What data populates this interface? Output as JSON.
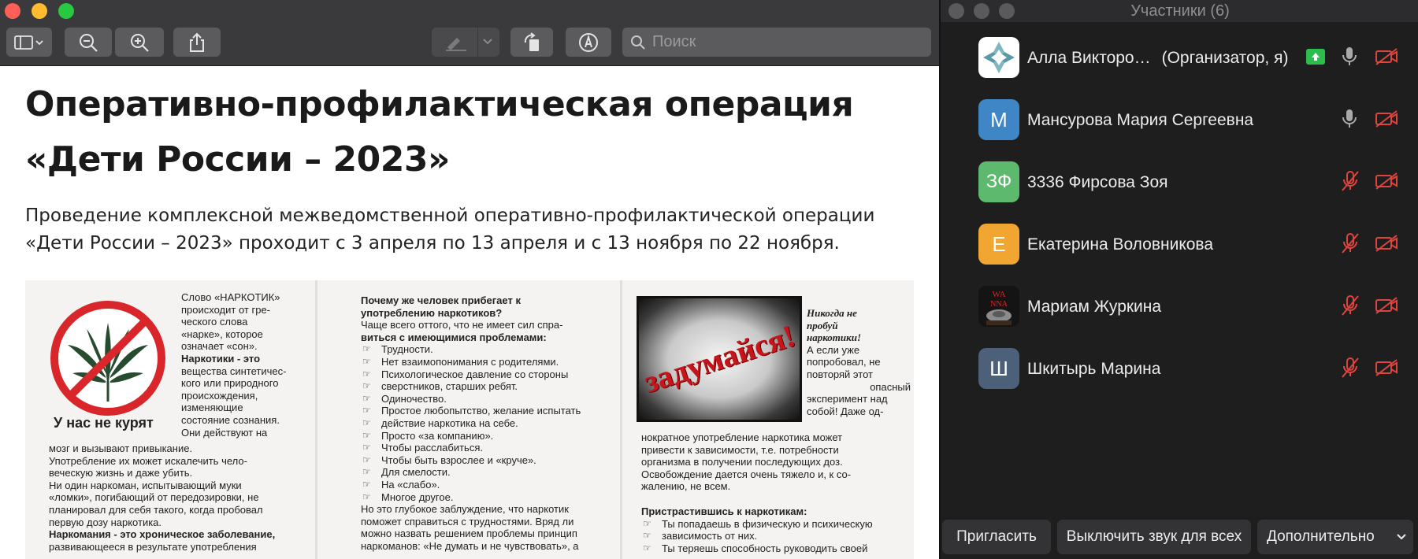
{
  "preview": {
    "search_placeholder": "Поиск",
    "article": {
      "title_line1": "Оперативно-профилактическая операция",
      "title_line2": "«Дети России – 2023»",
      "lead_line1": "Проведение комплексной межведомственной оперативно-профилактической операции",
      "lead_line2": "«Дети России – 2023» проходит с 3 апреля по 13 апреля и с 13 ноября по 22 ноября."
    },
    "scan": {
      "col1": {
        "intro": [
          "Слово «НАРКОТИК»",
          "происходит от гре-",
          "ческого слова",
          "«нарке», которое",
          "означает «сон»."
        ],
        "def": [
          "Наркотики - это",
          "вещества синтетичес-",
          "кого или природного",
          "происхождения,",
          "изменяющие",
          "состояние сознания.",
          "Они действуют на"
        ],
        "caption": "У нас не курят",
        "body": [
          "мозг и вызывают привыкание.",
          "Употребление их может искалечить чело-",
          "веческую жизнь и даже убить.",
          "Ни один наркоман, испытывающий муки",
          "«ломки», погибающий от передозировки, не",
          "планировал для себя такого, когда пробовал",
          "первую дозу наркотика.",
          "Наркомания - это хроническое заболевание,",
          "развивающееся в результате употребления"
        ]
      },
      "col2": {
        "heading": [
          "Почему же человек прибегает к",
          "употреблению наркотиков?"
        ],
        "intro": [
          "Чаще всего оттого, что не имеет сил спра-",
          "виться с имеющимися проблемами:"
        ],
        "items": [
          "Трудности.",
          "Нет взаимопонимания с родителями.",
          "Психологическое давление со стороны",
          "сверстников, старших ребят.",
          "Одиночество.",
          "Простое любопытство, желание испытать",
          "действие наркотика на себе.",
          "Просто «за компанию».",
          "Чтобы расслабиться.",
          "Чтобы быть взрослее и «круче».",
          "Для смелости.",
          "На «слабо».",
          "Многое другое."
        ],
        "outro": [
          "Но это глубокое заблуждение, что наркотик",
          "поможет справиться с трудностями. Вряд ли",
          "можно назвать решением проблемы принцип",
          "наркоманов: «Не думать и не чувствовать», а"
        ]
      },
      "col3": {
        "poster_text": "задумайся!",
        "side": [
          "Никогда не",
          "пробуй",
          "наркотики!",
          "А если уже",
          "попробовал, не",
          "повторяй этот",
          "опасный",
          "эксперимент над",
          "собой! Даже од-"
        ],
        "body": [
          "нократное употребление наркотика может",
          "привести к зависимости, т.е. потребности",
          "организма в получении последующих доз.",
          "Освобождение дается очень тяжело и, к со-",
          "жалению, не всем."
        ],
        "heading": "Пристрастившись к наркотикам:",
        "items": [
          "Ты попадаешь в физическую и психическую",
          "зависимость от них.",
          "Ты теряешь способность руководить своей"
        ]
      }
    }
  },
  "zoom": {
    "title": "Участники (6)",
    "participants": [
      {
        "name": "Алла Викторо…",
        "role": "(Организатор, я)",
        "initials": "",
        "avatar_color": "#ffffff",
        "mic": "on",
        "video": "off",
        "sharing": true
      },
      {
        "name": "Мансурова Мария Сергеевна",
        "role": "",
        "initials": "М",
        "avatar_color": "#3e86c5",
        "mic": "on",
        "video": "off",
        "sharing": false
      },
      {
        "name": "3336 Фирсова Зоя",
        "role": "",
        "initials": "ЗФ",
        "avatar_color": "#5db96e",
        "mic": "muted",
        "video": "off",
        "sharing": false
      },
      {
        "name": "Екатерина Воловникова",
        "role": "",
        "initials": "Е",
        "avatar_color": "#f0a630",
        "mic": "muted",
        "video": "off",
        "sharing": false
      },
      {
        "name": "Мариам Журкина",
        "role": "",
        "initials": "",
        "avatar_color": "#111111",
        "mic": "muted",
        "video": "off",
        "sharing": false
      },
      {
        "name": "Шкитырь Марина",
        "role": "",
        "initials": "Ш",
        "avatar_color": "#4c6079",
        "mic": "muted",
        "video": "off",
        "sharing": false
      }
    ],
    "footer": {
      "invite": "Пригласить",
      "mute_all": "Выключить звук для всех",
      "more": "Дополнительно"
    }
  }
}
